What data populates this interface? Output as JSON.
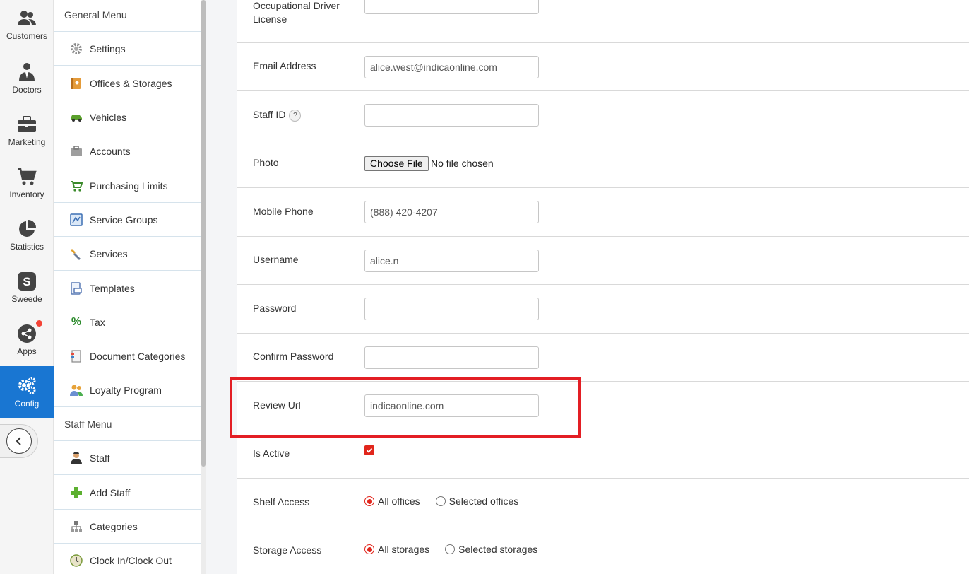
{
  "rail": {
    "items": [
      {
        "label": "Customers",
        "icon": "customers-icon"
      },
      {
        "label": "Doctors",
        "icon": "doctor-icon"
      },
      {
        "label": "Marketing",
        "icon": "briefcase-icon"
      },
      {
        "label": "Inventory",
        "icon": "cart-icon"
      },
      {
        "label": "Statistics",
        "icon": "pie-chart-icon"
      },
      {
        "label": "Sweede",
        "icon": "sweede-icon"
      },
      {
        "label": "Apps",
        "icon": "share-icon"
      },
      {
        "label": "Config",
        "icon": "gears-icon"
      }
    ],
    "active": "Config",
    "accent": "#1976d2"
  },
  "menu": {
    "general_title": "General Menu",
    "general_items": [
      {
        "label": "Settings",
        "icon": "gear-icon"
      },
      {
        "label": "Offices & Storages",
        "icon": "address-book-icon"
      },
      {
        "label": "Vehicles",
        "icon": "car-icon"
      },
      {
        "label": "Accounts",
        "icon": "briefcase-icon"
      },
      {
        "label": "Purchasing Limits",
        "icon": "cart-limit-icon"
      },
      {
        "label": "Service Groups",
        "icon": "service-groups-icon"
      },
      {
        "label": "Services",
        "icon": "tools-icon"
      },
      {
        "label": "Templates",
        "icon": "template-icon"
      },
      {
        "label": "Tax",
        "icon": "percent-icon"
      },
      {
        "label": "Document Categories",
        "icon": "documents-icon"
      },
      {
        "label": "Loyalty Program",
        "icon": "users-icon"
      }
    ],
    "staff_title": "Staff Menu",
    "staff_items": [
      {
        "label": "Staff",
        "icon": "person-icon"
      },
      {
        "label": "Add Staff",
        "icon": "plus-icon"
      },
      {
        "label": "Categories",
        "icon": "hierarchy-icon"
      },
      {
        "label": "Clock In/Clock Out",
        "icon": "clock-icon"
      }
    ]
  },
  "form": {
    "occupational_label_1": "Occupational Driver",
    "occupational_label_2": "License",
    "email_label": "Email Address",
    "email_value": "alice.west@indicaonline.com",
    "staff_id_label": "Staff ID",
    "staff_id_help": "?",
    "staff_id_value": "",
    "photo_label": "Photo",
    "choose_file": "Choose File",
    "no_file": "No file chosen",
    "mobile_label": "Mobile Phone",
    "mobile_value": "(888) 420-4207",
    "username_label": "Username",
    "username_value": "alice.n",
    "password_label": "Password",
    "password_value": "",
    "confirm_label": "Confirm Password",
    "confirm_value": "",
    "review_label": "Review Url",
    "review_value": "indicaonline.com",
    "active_label": "Is Active",
    "active_checked": true,
    "shelf_label": "Shelf Access",
    "shelf_options": [
      "All offices",
      "Selected offices"
    ],
    "storage_label": "Storage Access",
    "storage_options": [
      "All storages",
      "Selected storages"
    ],
    "highlight_color": "#e31e24"
  }
}
